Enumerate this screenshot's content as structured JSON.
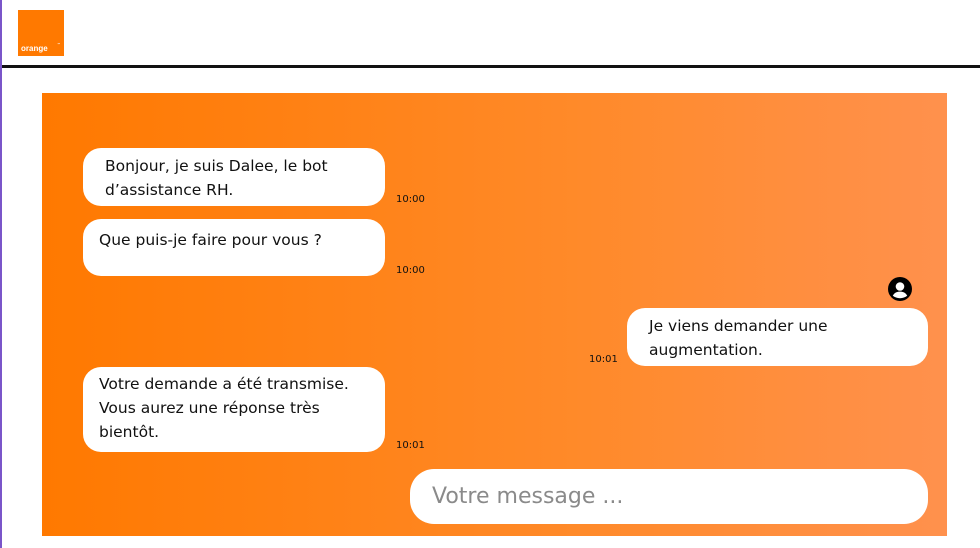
{
  "header": {
    "logo_text": "orange",
    "logo_mark": "™",
    "logo_color": "#ff7900"
  },
  "colors": {
    "accent": "#ff7900",
    "panel_end": "#ff914d",
    "bubble_bg": "#ffffff"
  },
  "messages": [
    {
      "sender": "bot",
      "text": "Bonjour, je suis Dalee, le bot d’assistance RH.",
      "time": "10:00"
    },
    {
      "sender": "bot",
      "text": "Que puis-je faire pour vous ?",
      "time": "10:00"
    },
    {
      "sender": "user",
      "text": "Je viens demander une augmentation.",
      "time": "10:01",
      "avatar_icon": "user-circle-icon"
    },
    {
      "sender": "bot",
      "text": "Votre demande a été transmise. Vous aurez une réponse très bientôt.",
      "time": "10:01"
    }
  ],
  "input": {
    "placeholder": "Votre message ..."
  }
}
